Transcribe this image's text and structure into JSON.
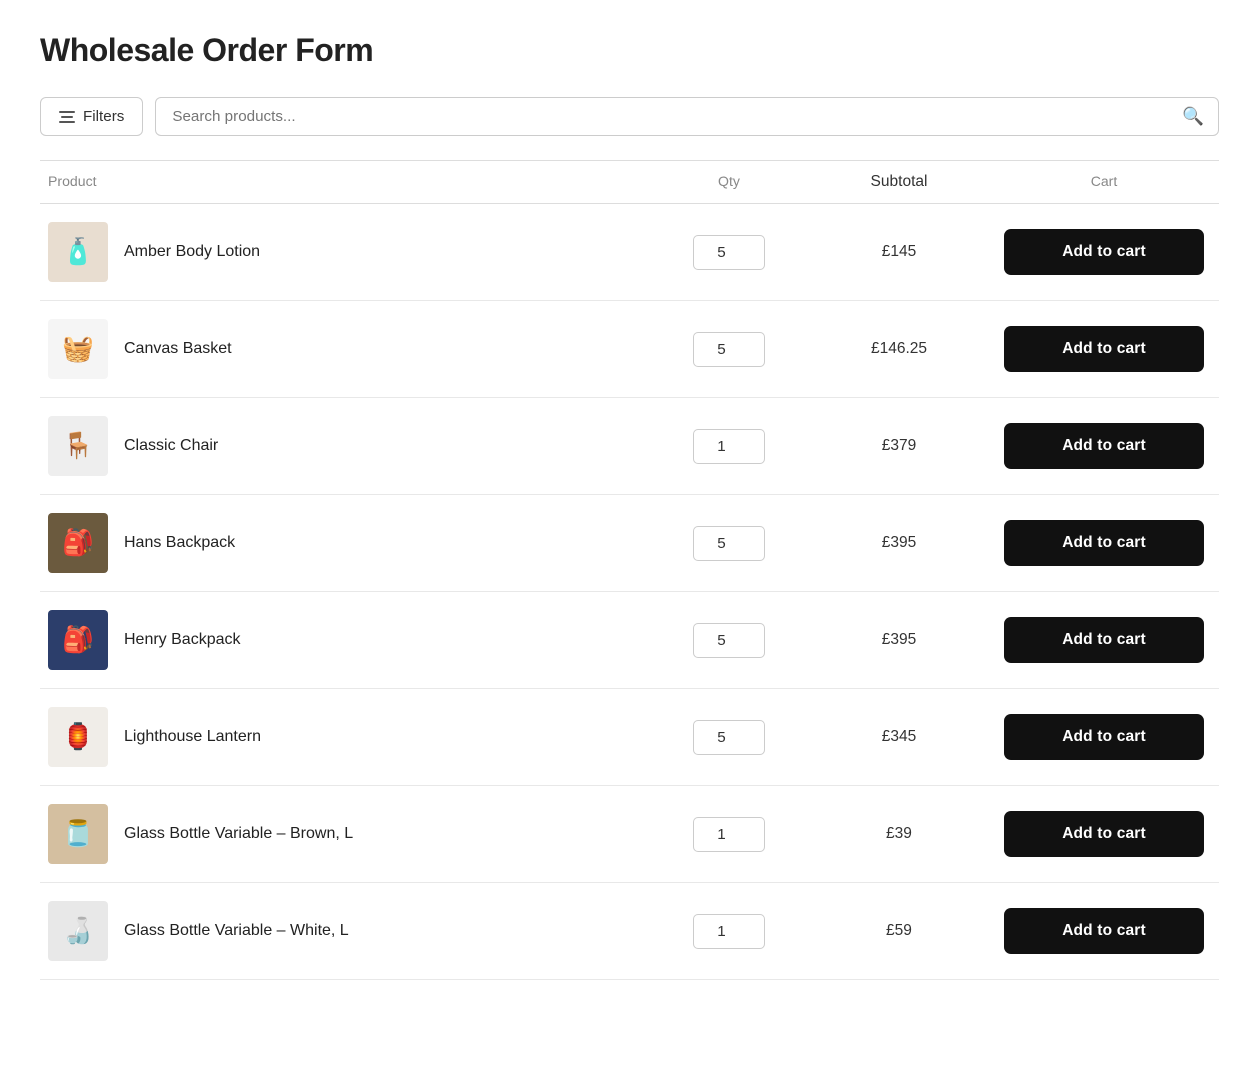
{
  "page": {
    "title": "Wholesale Order Form"
  },
  "toolbar": {
    "filters_label": "Filters",
    "search_placeholder": "Search products..."
  },
  "table": {
    "headers": {
      "product": "Product",
      "qty": "Qty",
      "subtotal": "Subtotal",
      "cart": "Cart"
    },
    "add_to_cart_label": "Add to cart",
    "rows": [
      {
        "id": "amber-body-lotion",
        "name": "Amber Body Lotion",
        "qty": "5",
        "subtotal": "£145",
        "thumb_class": "thumb-amber",
        "thumb_icon": "🧴"
      },
      {
        "id": "canvas-basket",
        "name": "Canvas Basket",
        "qty": "5",
        "subtotal": "£146.25",
        "thumb_class": "thumb-basket",
        "thumb_icon": "🧺"
      },
      {
        "id": "classic-chair",
        "name": "Classic Chair",
        "qty": "1",
        "subtotal": "£379",
        "thumb_class": "thumb-chair",
        "thumb_icon": "🪑"
      },
      {
        "id": "hans-backpack",
        "name": "Hans Backpack",
        "qty": "5",
        "subtotal": "£395",
        "thumb_class": "thumb-hans",
        "thumb_icon": "🎒"
      },
      {
        "id": "henry-backpack",
        "name": "Henry Backpack",
        "qty": "5",
        "subtotal": "£395",
        "thumb_class": "thumb-henry",
        "thumb_icon": "🎒"
      },
      {
        "id": "lighthouse-lantern",
        "name": "Lighthouse Lantern",
        "qty": "5",
        "subtotal": "£345",
        "thumb_class": "thumb-lantern",
        "thumb_icon": "🏮"
      },
      {
        "id": "glass-bottle-brown",
        "name": "Glass Bottle Variable – Brown, L",
        "qty": "1",
        "subtotal": "£39",
        "thumb_class": "thumb-glass-brown",
        "thumb_icon": "🫙"
      },
      {
        "id": "glass-bottle-white",
        "name": "Glass Bottle Variable – White, L",
        "qty": "1",
        "subtotal": "£59",
        "thumb_class": "thumb-glass-white",
        "thumb_icon": "🍶"
      }
    ]
  }
}
